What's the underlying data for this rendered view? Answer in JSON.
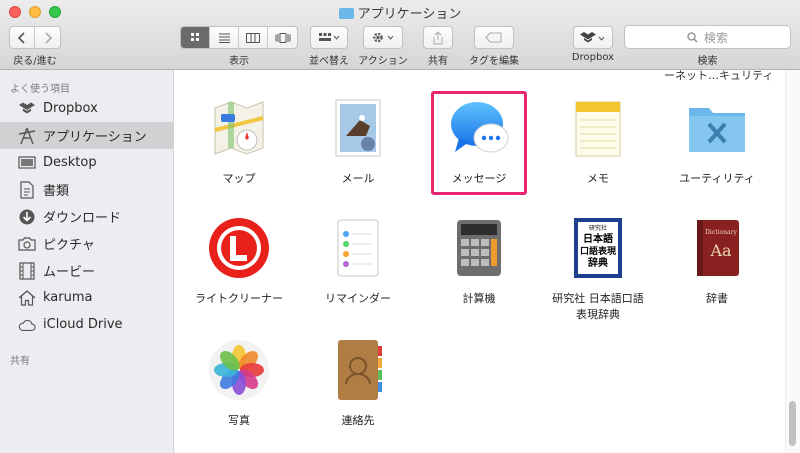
{
  "window": {
    "title": "アプリケーション"
  },
  "toolbar": {
    "back_forward_label": "戻る/進む",
    "view_label": "表示",
    "arrange_label": "並べ替え",
    "action_label": "アクション",
    "share_label": "共有",
    "tags_label": "タグを編集",
    "dropbox_label": "Dropbox",
    "search_label": "検索",
    "search_placeholder": "検索"
  },
  "sidebar": {
    "favorites_heading": "よく使う項目",
    "items": [
      {
        "label": "Dropbox",
        "icon": "dropbox-icon"
      },
      {
        "label": "アプリケーション",
        "icon": "applications-icon"
      },
      {
        "label": "Desktop",
        "icon": "desktop-icon"
      },
      {
        "label": "書類",
        "icon": "documents-icon"
      },
      {
        "label": "ダウンロード",
        "icon": "downloads-icon"
      },
      {
        "label": "ピクチャ",
        "icon": "pictures-icon"
      },
      {
        "label": "ムービー",
        "icon": "movies-icon"
      },
      {
        "label": "karuma",
        "icon": "home-icon"
      },
      {
        "label": "iCloud Drive",
        "icon": "icloud-icon"
      }
    ],
    "shared_heading": "共有"
  },
  "content": {
    "partial_label": "ーネット…キュリティ",
    "apps": [
      {
        "label": "マップ",
        "icon": "maps-icon"
      },
      {
        "label": "メール",
        "icon": "mail-icon"
      },
      {
        "label": "メッセージ",
        "icon": "messages-icon"
      },
      {
        "label": "メモ",
        "icon": "notes-icon"
      },
      {
        "label": "ユーティリティ",
        "icon": "utilities-folder-icon"
      },
      {
        "label": "ライトクリーナー",
        "icon": "light-cleaner-icon"
      },
      {
        "label": "リマインダー",
        "icon": "reminders-icon"
      },
      {
        "label": "計算機",
        "icon": "calculator-icon"
      },
      {
        "label": "研究社 日本語口語表現辞典",
        "icon": "kenkyusha-dictionary-icon"
      },
      {
        "label": "辞書",
        "icon": "dictionary-icon"
      },
      {
        "label": "写真",
        "icon": "photos-icon"
      },
      {
        "label": "連絡先",
        "icon": "contacts-icon"
      }
    ],
    "dictionary_icon_text": [
      "研究社",
      "日本語",
      "口語表現",
      "辞典"
    ],
    "dictionary_app_text": [
      "Dictionary",
      "Aa"
    ]
  },
  "colors": {
    "highlight": "#e8246f",
    "sidebar_bg": "#ecedf0",
    "selected_item_bg": "#d1d1d4"
  }
}
